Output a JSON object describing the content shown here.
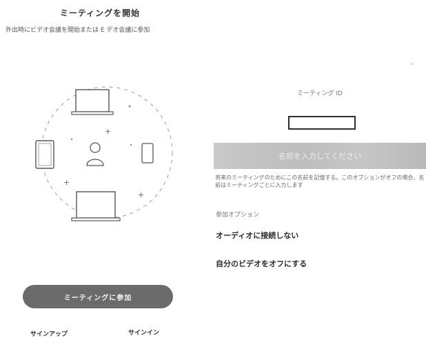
{
  "header": {
    "title": "ミーティングを開始",
    "subtitle": "外出時にビデオ会議を開始または E デオ会議に参加"
  },
  "left": {
    "join_button": "ミーティングに参加",
    "sign_up": "サインアップ",
    "sign_in": "サインイン",
    "plus_symbol": "+"
  },
  "right": {
    "dropdown_chevron": "⌄",
    "meeting_hint": "ミーティング ID",
    "meeting_id_value": "",
    "name_placeholder": "名前を入力してください",
    "remember_note": "将来のミーティングのためにこの名前を記憶する。このオプションがオフの場合、名前はミーティングごとに入力します",
    "options_label": "参加オプション",
    "opt_no_audio": "オーディオに接続しない",
    "opt_video_off": "自分のビデオをオフにする"
  },
  "colors": {
    "join_button_bg": "#6b6b6b",
    "name_bar_bg": "#c2c2c2",
    "input_border": "#2e2e2e"
  },
  "icons": [
    "laptop-icon",
    "tablet-icon",
    "phone-icon",
    "user-icon",
    "chevron-down-icon"
  ]
}
